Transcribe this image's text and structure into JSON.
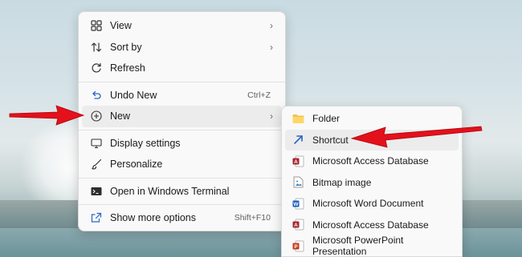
{
  "colors": {
    "arrow": "#e3111b",
    "menu_bg": "#f9f9f9",
    "hover_bg": "#ececec"
  },
  "context_menu": {
    "items": [
      {
        "label": "View",
        "icon": "grid-view-icon",
        "submenu": true
      },
      {
        "label": "Sort by",
        "icon": "sort-icon",
        "submenu": true
      },
      {
        "label": "Refresh",
        "icon": "refresh-icon"
      },
      {
        "label": "Undo New",
        "icon": "undo-icon",
        "shortcut": "Ctrl+Z"
      },
      {
        "label": "New",
        "icon": "add-circle-icon",
        "submenu": true,
        "highlighted": true
      },
      {
        "label": "Display settings",
        "icon": "display-icon"
      },
      {
        "label": "Personalize",
        "icon": "brush-icon"
      },
      {
        "label": "Open in Windows Terminal",
        "icon": "terminal-icon"
      },
      {
        "label": "Show more options",
        "icon": "share-icon",
        "shortcut": "Shift+F10"
      }
    ]
  },
  "new_submenu": {
    "items": [
      {
        "label": "Folder",
        "icon": "folder-icon"
      },
      {
        "label": "Shortcut",
        "icon": "shortcut-arrow-icon",
        "highlighted": true
      },
      {
        "label": "Microsoft Access Database",
        "icon": "access-icon"
      },
      {
        "label": "Bitmap image",
        "icon": "bitmap-icon"
      },
      {
        "label": "Microsoft Word Document",
        "icon": "word-icon"
      },
      {
        "label": "Microsoft Access Database",
        "icon": "access-icon"
      },
      {
        "label": "Microsoft PowerPoint Presentation",
        "icon": "powerpoint-icon"
      }
    ]
  }
}
